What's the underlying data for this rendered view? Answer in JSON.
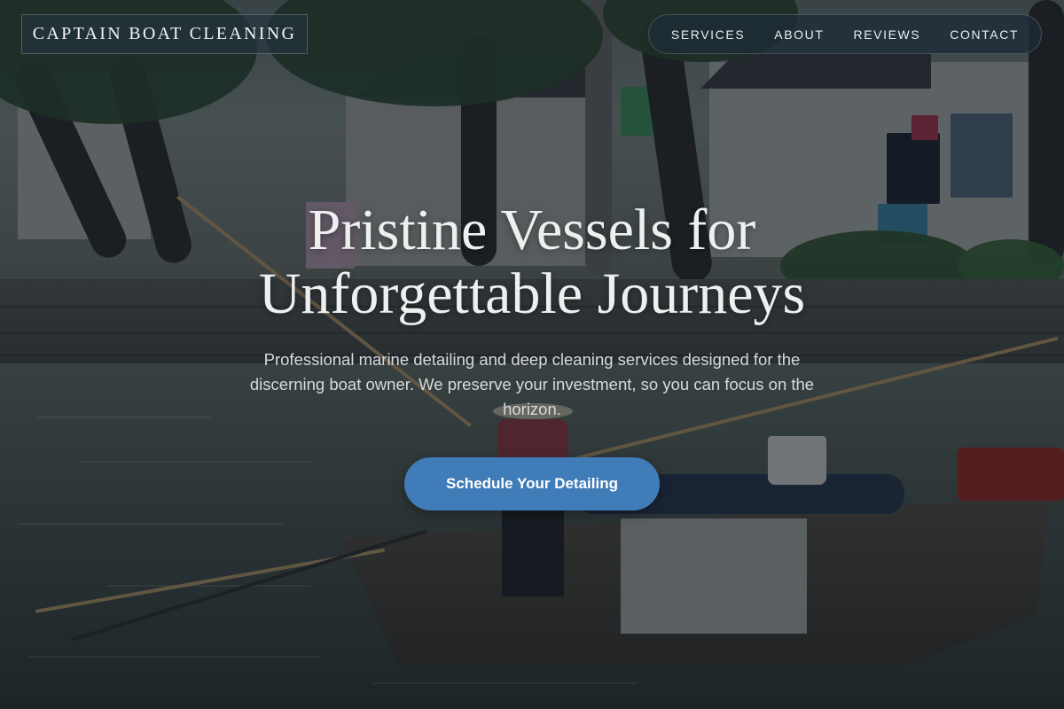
{
  "header": {
    "brand": "CAPTAIN BOAT CLEANING",
    "nav": [
      {
        "label": "SERVICES"
      },
      {
        "label": "ABOUT"
      },
      {
        "label": "REVIEWS"
      },
      {
        "label": "CONTACT"
      }
    ]
  },
  "hero": {
    "headline_line1": "Pristine Vessels for",
    "headline_line2": "Unforgettable Journeys",
    "subtext": "Professional marine detailing and deep cleaning services designed for the discerning boat owner. We preserve your investment, so you can focus on the horizon.",
    "cta_label": "Schedule Your Detailing"
  },
  "colors": {
    "accent": "#3f7cb8",
    "overlay": "#0e1822"
  }
}
